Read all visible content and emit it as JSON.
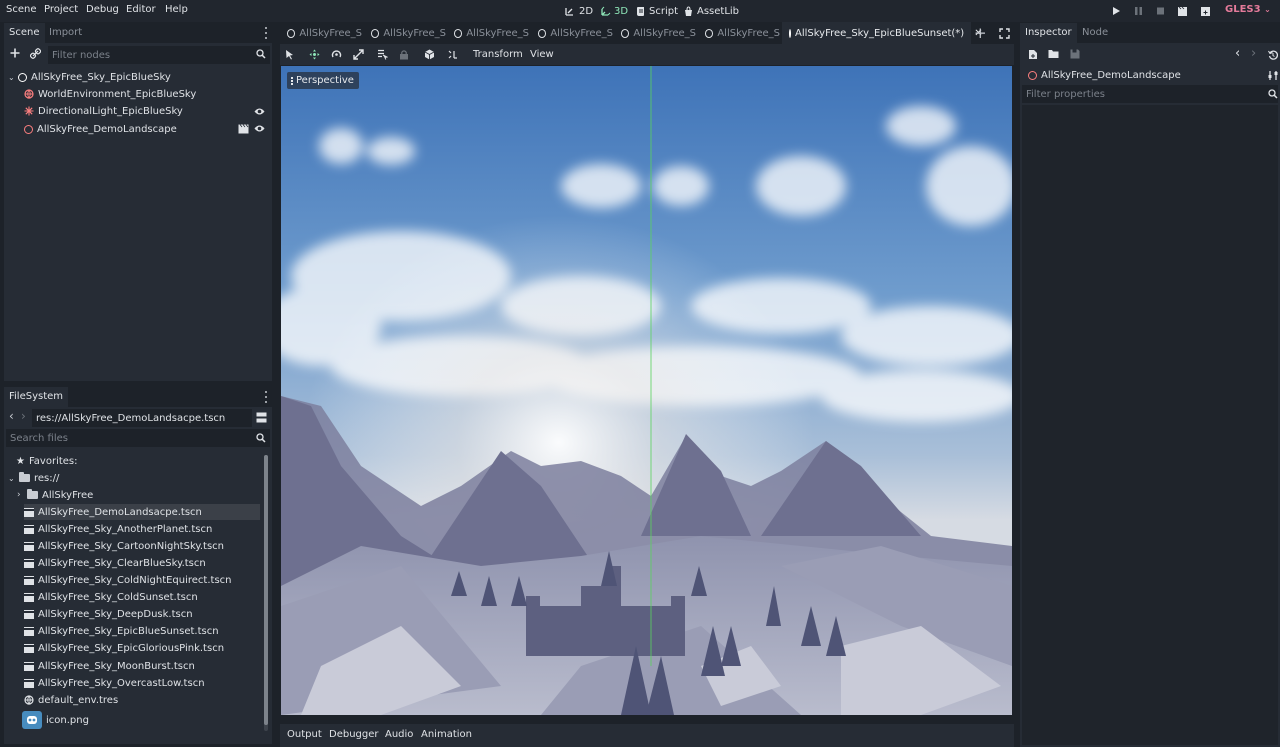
{
  "menubar": {
    "items": [
      "Scene",
      "Project",
      "Debug",
      "Editor",
      "Help"
    ],
    "workspaces": [
      {
        "label": "2D",
        "icon": "2d-icon"
      },
      {
        "label": "3D",
        "icon": "3d-icon",
        "active": true
      },
      {
        "label": "Script",
        "icon": "script-icon"
      },
      {
        "label": "AssetLib",
        "icon": "assetlib-icon"
      }
    ],
    "renderer": "GLES3",
    "renderer_color": "#e57b9b"
  },
  "scene_dock": {
    "tabs": [
      "Scene",
      "Import"
    ],
    "filter_placeholder": "Filter nodes",
    "nodes": [
      {
        "label": "AllSkyFree_Sky_EpicBlueSky",
        "icon": "spatial-node-icon"
      },
      {
        "label": "WorldEnvironment_EpicBlueSky",
        "icon": "world-environment-icon"
      },
      {
        "label": "DirectionalLight_EpicBlueSky",
        "icon": "directional-light-icon"
      },
      {
        "label": "AllSkyFree_DemoLandscape",
        "icon": "instanced-scene-icon"
      }
    ]
  },
  "filesystem_dock": {
    "tab": "FileSystem",
    "path": "res://AllSkyFree_DemoLandsacpe.tscn",
    "search_placeholder": "Search files",
    "favorites": "Favorites:",
    "root": "res://",
    "items": [
      {
        "label": "AllSkyFree",
        "type": "folder"
      },
      {
        "label": "AllSkyFree_DemoLandsacpe.tscn",
        "type": "scene",
        "selected": true
      },
      {
        "label": "AllSkyFree_Sky_AnotherPlanet.tscn",
        "type": "scene"
      },
      {
        "label": "AllSkyFree_Sky_CartoonNightSky.tscn",
        "type": "scene"
      },
      {
        "label": "AllSkyFree_Sky_ClearBlueSky.tscn",
        "type": "scene"
      },
      {
        "label": "AllSkyFree_Sky_ColdNightEquirect.tscn",
        "type": "scene"
      },
      {
        "label": "AllSkyFree_Sky_ColdSunset.tscn",
        "type": "scene"
      },
      {
        "label": "AllSkyFree_Sky_DeepDusk.tscn",
        "type": "scene"
      },
      {
        "label": "AllSkyFree_Sky_EpicBlueSunset.tscn",
        "type": "scene"
      },
      {
        "label": "AllSkyFree_Sky_EpicGloriousPink.tscn",
        "type": "scene"
      },
      {
        "label": "AllSkyFree_Sky_MoonBurst.tscn",
        "type": "scene"
      },
      {
        "label": "AllSkyFree_Sky_OvercastLow.tscn",
        "type": "scene"
      },
      {
        "label": "default_env.tres",
        "type": "environment"
      },
      {
        "label": "icon.png",
        "type": "image"
      }
    ]
  },
  "editor": {
    "tabs": [
      "AllSkyFree_S",
      "AllSkyFree_S",
      "AllSkyFree_S",
      "AllSkyFree_S",
      "AllSkyFree_S",
      "AllSkyFree_S",
      "AllSkyFree_Sky_EpicBlueSunset(*)"
    ],
    "toolbar": {
      "transform": "Transform",
      "view": "View"
    },
    "perspective_label": "Perspective",
    "bottom_tabs": [
      "Output",
      "Debugger",
      "Audio",
      "Animation"
    ]
  },
  "inspector": {
    "tabs": [
      "Inspector",
      "Node"
    ],
    "object_name": "AllSkyFree_DemoLandscape",
    "filter_placeholder": "Filter properties"
  }
}
